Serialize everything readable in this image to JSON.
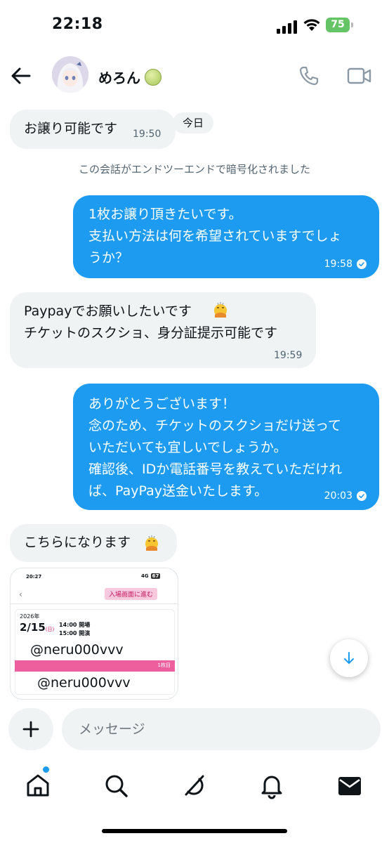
{
  "status_bar": {
    "time": "22:18",
    "battery": "75"
  },
  "header": {
    "contact_name": "めろん"
  },
  "chat": {
    "today_label": "今日",
    "encryption_notice": "この会話がエンドツーエンドで暗号化されました",
    "messages": [
      {
        "direction": "in",
        "text": "お譲り可能です",
        "time": "19:50"
      },
      {
        "direction": "out",
        "text": "1枚お譲り頂きたいです。\n支払い方法は何を希望されていますでしょ\nうか？",
        "time": "19:58"
      },
      {
        "direction": "in",
        "text": "Paypayでお願いしたいです\nチケットのスクショ、身分証提示可能です",
        "time": "19:59"
      },
      {
        "direction": "out",
        "text": "ありがとうございます！\n念のため、チケットのスクショだけ送って\nいただいても宜しいでしょうか。\n確認後、IDか電話番号を教えていただけれ\nば、PayPay送金いたします。",
        "time": "20:03"
      },
      {
        "direction": "in",
        "text": "こちらになります",
        "time": ""
      }
    ],
    "image_preview": {
      "time": "20:27",
      "network": "4G",
      "battery": "67",
      "enter_button": "入場画面に進む",
      "year": "2026年",
      "date": "2/15",
      "weekday": "(日)",
      "open_time": "14:00 開場",
      "start_time": "15:00 開演",
      "seat_label": "1枚目",
      "watermark_1": "@neru000vvv",
      "watermark_2": "@neru000vvv"
    }
  },
  "composer": {
    "placeholder": "メッセージ"
  },
  "colors": {
    "accent": "#1d9bf0",
    "incoming_bubble": "#eff3f4",
    "battery": "#65c466"
  },
  "icons": [
    "back-arrow-icon",
    "phone-icon",
    "video-icon",
    "plus-icon",
    "home-icon",
    "search-icon",
    "grok-icon",
    "bell-icon",
    "mail-icon",
    "arrow-down-icon",
    "read-check-icon"
  ]
}
